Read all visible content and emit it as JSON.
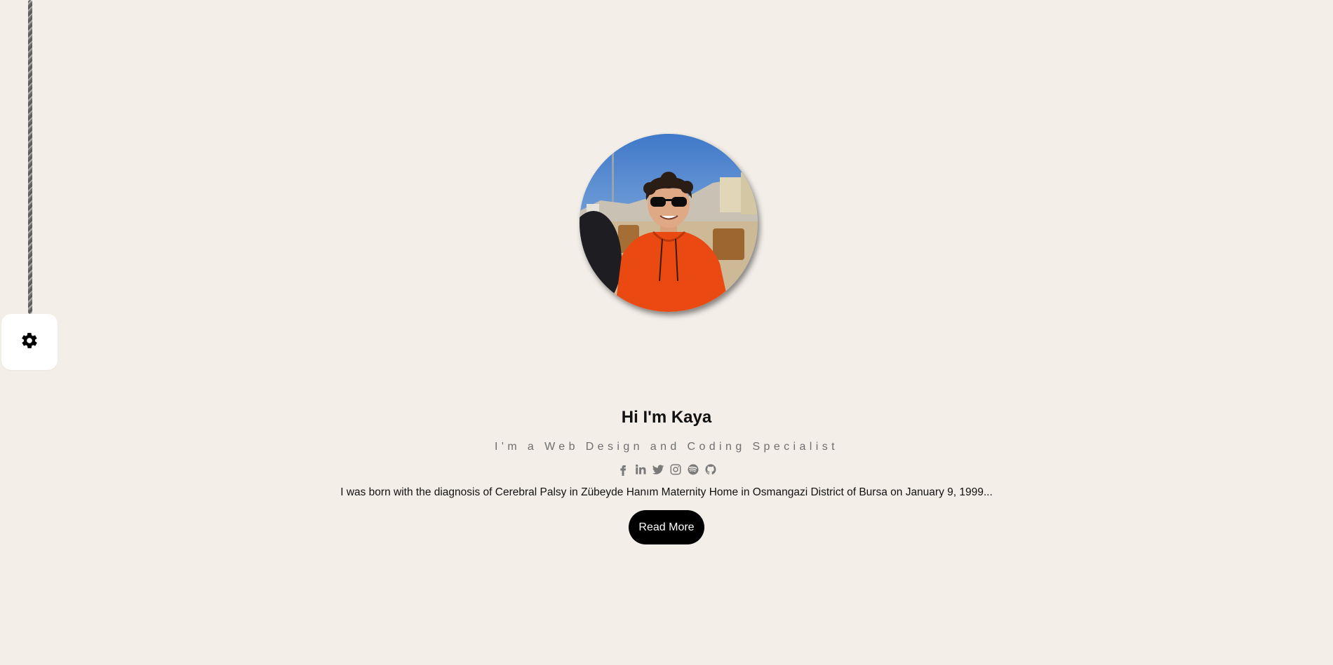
{
  "settings": {
    "icon": "gear-icon"
  },
  "profile": {
    "photo_alt": "Profile photo",
    "name": "Hi I'm Kaya",
    "role": "I'm a Web Design and Coding Specialist",
    "bio": "I was born with the diagnosis of Cerebral Palsy in Zübeyde Hanım Maternity Home in Osmangazi District of Bursa on January 9, 1999...",
    "read_more_label": "Read More"
  },
  "socials": [
    {
      "name": "facebook",
      "icon": "facebook-icon"
    },
    {
      "name": "linkedin",
      "icon": "linkedin-icon"
    },
    {
      "name": "twitter",
      "icon": "twitter-icon"
    },
    {
      "name": "instagram",
      "icon": "instagram-icon"
    },
    {
      "name": "spotify",
      "icon": "spotify-icon"
    },
    {
      "name": "github",
      "icon": "github-icon"
    }
  ],
  "colors": {
    "background": "#f3eee8",
    "text": "#111111",
    "muted": "#6f6f6f",
    "button": "#000000",
    "icon": "#7a7a7a"
  }
}
